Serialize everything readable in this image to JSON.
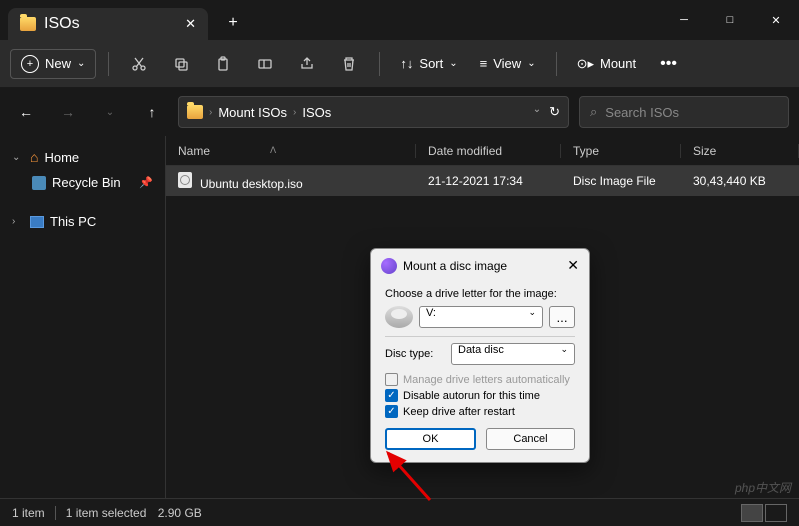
{
  "window": {
    "title": "ISOs"
  },
  "toolbar": {
    "new_label": "New",
    "sort_label": "Sort",
    "view_label": "View",
    "mount_label": "Mount"
  },
  "breadcrumb": {
    "parts": [
      "Mount ISOs",
      "ISOs"
    ]
  },
  "search": {
    "placeholder": "Search ISOs"
  },
  "sidebar": {
    "home": "Home",
    "recycle": "Recycle Bin",
    "thispc": "This PC"
  },
  "columns": {
    "name": "Name",
    "date": "Date modified",
    "type": "Type",
    "size": "Size"
  },
  "file": {
    "name": "Ubuntu desktop.iso",
    "date": "21-12-2021 17:34",
    "type": "Disc Image File",
    "size": "30,43,440 KB"
  },
  "status": {
    "count": "1 item",
    "selected": "1 item selected",
    "size": "2.90 GB"
  },
  "dialog": {
    "title": "Mount a disc image",
    "choose_label": "Choose a drive letter for the image:",
    "drive_value": "V:",
    "browse_label": "...",
    "disc_type_label": "Disc type:",
    "disc_type_value": "Data disc",
    "opt_manage": "Manage drive letters automatically",
    "opt_autorun": "Disable autorun for this time",
    "opt_keep": "Keep drive after restart",
    "ok": "OK",
    "cancel": "Cancel"
  },
  "watermark": "php中文网"
}
